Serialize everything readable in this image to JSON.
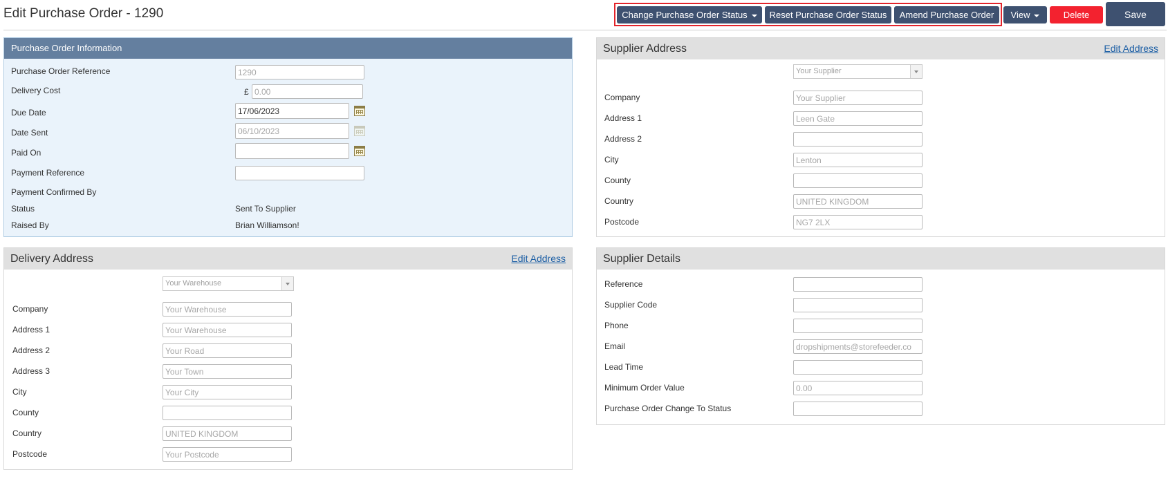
{
  "header": {
    "title": "Edit Purchase Order - 1290",
    "buttons": {
      "change_status": "Change Purchase Order Status",
      "reset_status": "Reset Purchase Order Status",
      "amend": "Amend Purchase Order",
      "view": "View",
      "delete": "Delete",
      "save": "Save"
    },
    "colors": {
      "dark_button": "#3e5170",
      "delete_button": "#f3222f",
      "highlight": "#e3242b"
    }
  },
  "po_info": {
    "title": "Purchase Order Information",
    "labels": {
      "reference": "Purchase Order Reference",
      "delivery_cost": "Delivery Cost",
      "due_date": "Due Date",
      "date_sent": "Date Sent",
      "paid_on": "Paid On",
      "payment_reference": "Payment Reference",
      "payment_confirmed_by": "Payment Confirmed By",
      "status": "Status",
      "raised_by": "Raised By"
    },
    "values": {
      "reference": "1290",
      "currency_symbol": "£",
      "delivery_cost_placeholder": "0.00",
      "due_date": "17/06/2023",
      "date_sent": "06/10/2023",
      "paid_on": "",
      "payment_reference": "",
      "status": "Sent To Supplier",
      "raised_by": "Brian Williamson!"
    }
  },
  "delivery_address": {
    "title": "Delivery Address",
    "edit_link": "Edit Address",
    "select_value": "Your Warehouse",
    "labels": {
      "company": "Company",
      "address1": "Address 1",
      "address2": "Address 2",
      "address3": "Address 3",
      "city": "City",
      "county": "County",
      "country": "Country",
      "postcode": "Postcode"
    },
    "placeholders": {
      "company": "Your Warehouse",
      "address1": "Your Warehouse",
      "address2": "Your Road",
      "address3": "Your Town",
      "city": "Your City",
      "county": "",
      "country": "UNITED KINGDOM",
      "postcode": "Your Postcode"
    }
  },
  "supplier_address": {
    "title": "Supplier Address",
    "edit_link": "Edit Address",
    "select_value": "Your Supplier",
    "labels": {
      "company": "Company",
      "address1": "Address 1",
      "address2": "Address 2",
      "city": "City",
      "county": "County",
      "country": "Country",
      "postcode": "Postcode"
    },
    "placeholders": {
      "company": "Your Supplier",
      "address1": "Leen Gate",
      "address2": "",
      "city": "Lenton",
      "county": "",
      "country": "UNITED KINGDOM",
      "postcode": "NG7 2LX"
    }
  },
  "supplier_details": {
    "title": "Supplier Details",
    "labels": {
      "reference": "Reference",
      "supplier_code": "Supplier Code",
      "phone": "Phone",
      "email": "Email",
      "lead_time": "Lead Time",
      "minimum_order_value": "Minimum Order Value",
      "po_change_status": "Purchase Order Change To Status"
    },
    "placeholders": {
      "reference": "",
      "supplier_code": "",
      "phone": "",
      "email": "dropshipments@storefeeder.co",
      "lead_time": "",
      "minimum_order_value": "0.00",
      "po_change_status": ""
    }
  }
}
